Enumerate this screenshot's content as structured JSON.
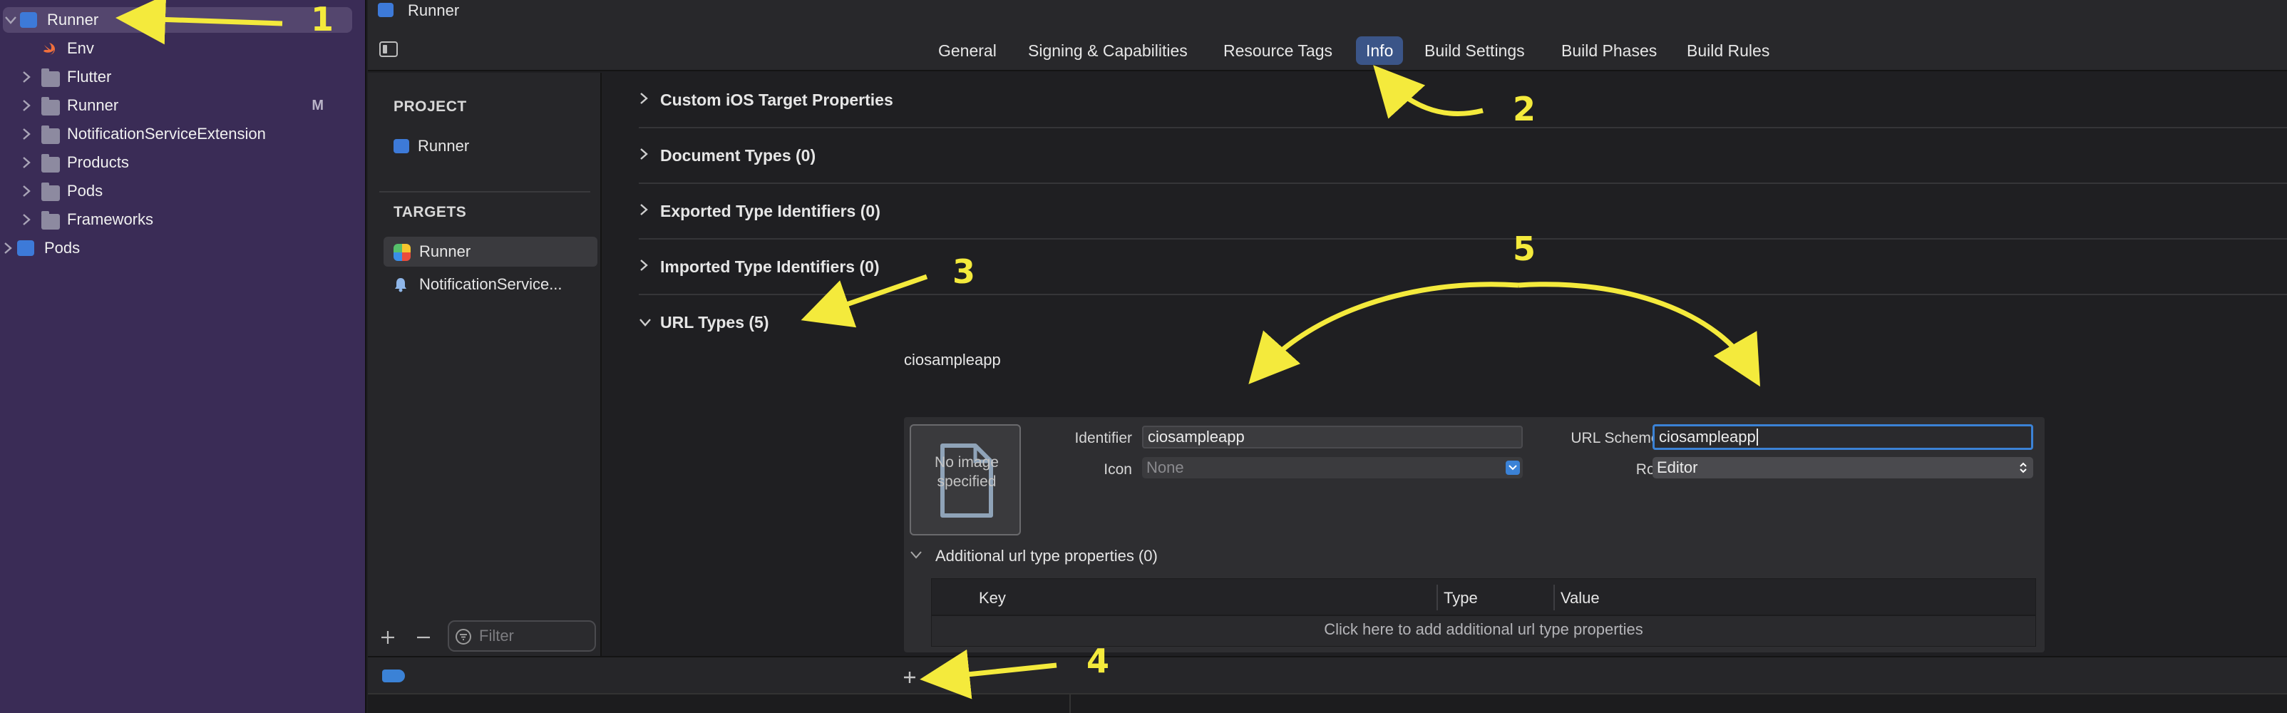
{
  "navigator": {
    "items": [
      {
        "label": "Runner",
        "icon": "xcodeproj-icon",
        "expanded": true
      },
      {
        "label": "Env",
        "icon": "swift-file-icon"
      },
      {
        "label": "Flutter",
        "icon": "folder-icon"
      },
      {
        "label": "Runner",
        "icon": "folder-icon",
        "badge": "M"
      },
      {
        "label": "NotificationServiceExtension",
        "icon": "folder-icon"
      },
      {
        "label": "Products",
        "icon": "folder-icon"
      },
      {
        "label": "Pods",
        "icon": "folder-icon"
      },
      {
        "label": "Frameworks",
        "icon": "folder-icon"
      },
      {
        "label": "Pods",
        "icon": "xcodeproj-icon"
      }
    ]
  },
  "editor": {
    "title": "Runner",
    "tabs": [
      "General",
      "Signing & Capabilities",
      "Resource Tags",
      "Info",
      "Build Settings",
      "Build Phases",
      "Build Rules"
    ],
    "active_tab": "Info"
  },
  "targets_pane": {
    "project_header": "PROJECT",
    "project_item": "Runner",
    "targets_header": "TARGETS",
    "targets": [
      "Runner",
      "NotificationService..."
    ],
    "filter_placeholder": "Filter"
  },
  "sections": [
    {
      "title": "Custom iOS Target Properties",
      "expanded": false
    },
    {
      "title": "Document Types (0)",
      "expanded": false
    },
    {
      "title": "Exported Type Identifiers (0)",
      "expanded": false
    },
    {
      "title": "Imported Type Identifiers (0)",
      "expanded": false
    },
    {
      "title": "URL Types (5)",
      "expanded": true
    }
  ],
  "url_type": {
    "name": "ciosampleapp",
    "image_placeholder": "No image specified",
    "identifier_label": "Identifier",
    "identifier_value": "ciosampleapp",
    "icon_label": "Icon",
    "icon_value": "None",
    "url_schemes_label": "URL Schemes",
    "url_schemes_value": "ciosampleapp",
    "role_label": "Role",
    "role_value": "Editor",
    "additional_title": "Additional url type properties (0)",
    "table_headers": [
      "Key",
      "Type",
      "Value"
    ],
    "table_empty": "Click here to add additional url type properties"
  },
  "annotations": [
    "1",
    "2",
    "3",
    "4",
    "5"
  ],
  "colors": {
    "accent": "#3b82d6",
    "annotation": "#f4ea3c",
    "sidebar": "#3a2c56"
  }
}
